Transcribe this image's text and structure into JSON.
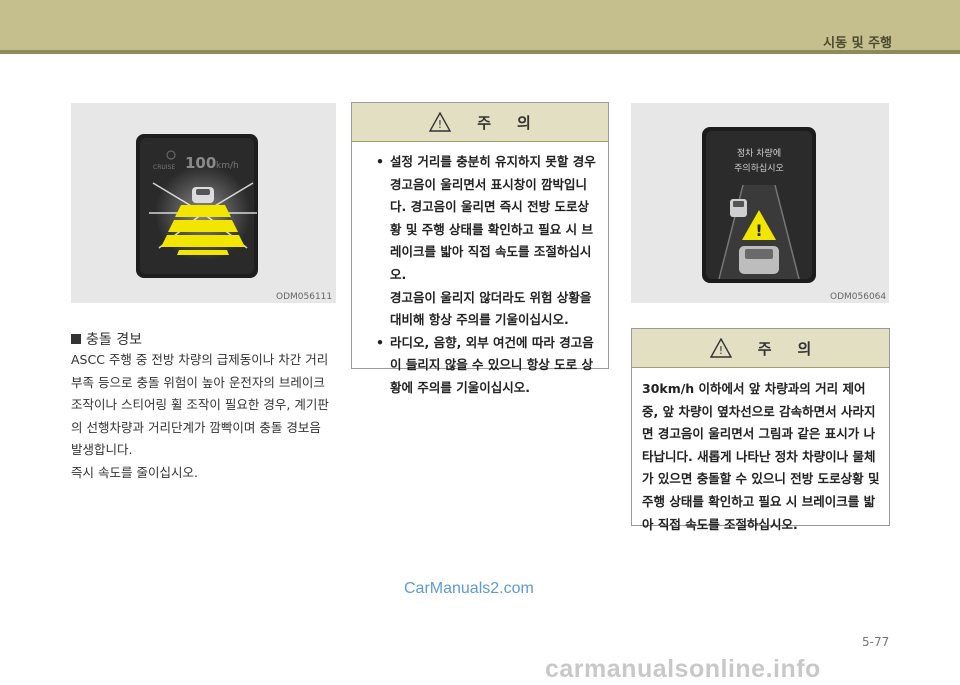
{
  "header": {
    "title": "시동 및 주행"
  },
  "figure1": {
    "code": "ODM056111",
    "display": {
      "cruise": "CRUISE",
      "speed": "100",
      "unit": "km/h"
    }
  },
  "section": {
    "title": "충돌 경보",
    "paragraphs": [
      "ASCC 주행 중 전방 차량의 급제동이나 차간 거리 부족 등으로 충돌 위험이 높아 운전자의 브레이크 조작이나 스티어링 휠 조작이 필요한 경우, 계기판의 선행차량과 거리단계가 깜빡이며 충돌 경보음 발생합니다.",
      "즉시 속도를 줄이십시오."
    ]
  },
  "caution1": {
    "title_a": "주",
    "title_b": "의",
    "items": [
      {
        "text": "설정 거리를 충분히 유지하지 못할 경우 경고음이 울리면서 표시창이 깜박입니다. 경고음이 울리면 즉시 전방 도로상황 및 주행 상태를 확인하고 필요 시 브레이크를 밟아 직접 속도를 조절하십시오.",
        "sub": "경고음이 울리지 않더라도 위험 상황을 대비해 항상 주의를 기울이십시오."
      },
      {
        "text": "라디오, 음향, 외부 여건에 따라 경고음이 들리지 않을 수 있으니 항상 도로 상황에 주의를 기울이십시오."
      }
    ]
  },
  "figure2": {
    "code": "ODM056064",
    "message_line1": "정차 차량에",
    "message_line2": "주의하십시오"
  },
  "caution2": {
    "title_a": "주",
    "title_b": "의",
    "body": "30km/h 이하에서 앞 차량과의 거리 제어 중, 앞 차량이 옆차선으로 감속하면서 사라지면 경고음이 울리면서 그림과 같은 표시가 나타납니다. 새롭게 나타난 정차 차량이나 물체가 있으면 충돌할 수 있으니 전방 도로상황 및 주행 상태를 확인하고 필요 시 브레이크를 밟아 직접 속도를 조절하십시오."
  },
  "watermark_top": "CarManuals2.com",
  "page_number": "5-77",
  "watermark_bottom": "carmanualsonline.info",
  "colors": {
    "topbar": "#c5bf8d",
    "caution_head": "#e2dfc2",
    "cluster_yellow": "#f2e600"
  }
}
